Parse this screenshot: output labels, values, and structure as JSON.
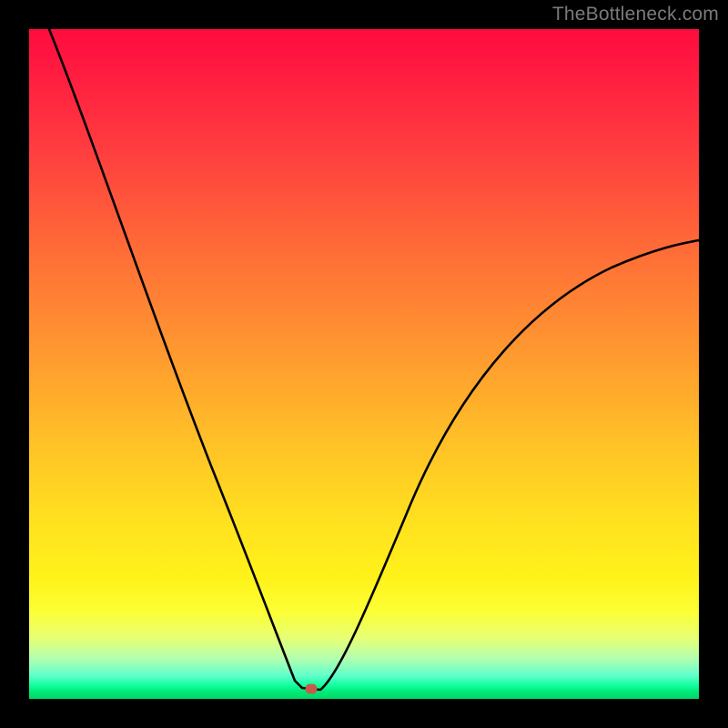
{
  "watermark": "TheBottleneck.com",
  "marker": {
    "x_frac": 0.422,
    "y_frac": 0.985,
    "color": "#c65b49"
  },
  "chart_data": {
    "type": "line",
    "title": "",
    "xlabel": "",
    "ylabel": "",
    "xlim": [
      0,
      100
    ],
    "ylim": [
      0,
      100
    ],
    "series": [
      {
        "name": "bottleneck-curve",
        "x": [
          3,
          8,
          13,
          18,
          23,
          28,
          33,
          37,
          40,
          42,
          44,
          46,
          51,
          56,
          62,
          70,
          80,
          90,
          100
        ],
        "values": [
          100,
          86,
          73,
          61,
          50,
          40,
          30,
          20,
          10,
          3,
          1,
          3,
          10,
          20,
          30,
          40,
          50,
          58,
          65
        ]
      }
    ],
    "marker_point": {
      "x": 42.2,
      "y": 1.5
    },
    "background_gradient": {
      "orientation": "vertical",
      "stops": [
        {
          "pos": 0.0,
          "color": "#ff0c3e"
        },
        {
          "pos": 0.5,
          "color": "#ff9830"
        },
        {
          "pos": 0.82,
          "color": "#fff21a"
        },
        {
          "pos": 0.95,
          "color": "#62ffcc"
        },
        {
          "pos": 1.0,
          "color": "#00d865"
        }
      ]
    }
  }
}
